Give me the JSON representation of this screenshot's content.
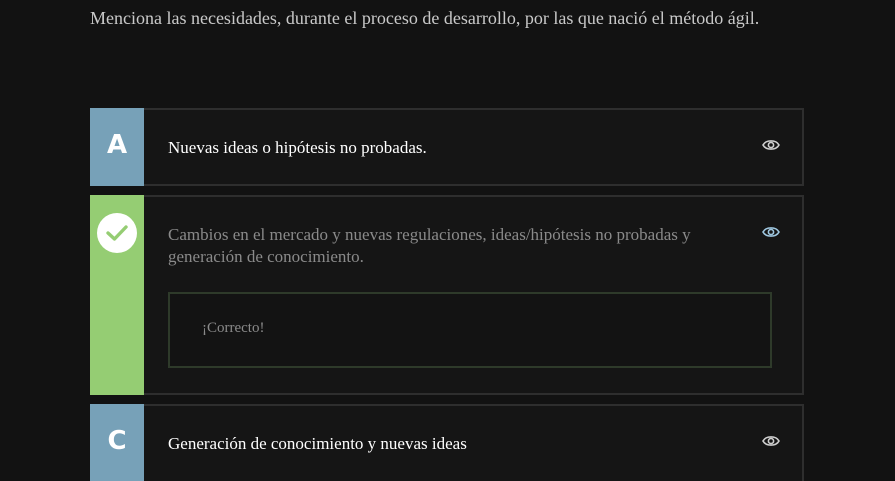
{
  "question": "Menciona las necesidades, durante el proceso de desarrollo, por las que nació el método ágil.",
  "options": [
    {
      "letter": "A",
      "text": "Nuevas ideas o hipótesis no probadas.",
      "state": "unselected",
      "tab_color": "#77a1b8"
    },
    {
      "letter": "",
      "text": "Cambios en el mercado y nuevas regulaciones, ideas/hipótesis no probadas y generación de conocimiento.",
      "state": "correct",
      "tab_color": "#95cd73",
      "icon": "check-icon",
      "feedback": "¡Correcto!"
    },
    {
      "letter": "C",
      "text": "Generación de conocimiento y nuevas ideas",
      "state": "unselected",
      "tab_color": "#77a1b8"
    }
  ],
  "icons": {
    "reveal": "eye-icon"
  },
  "colors": {
    "background": "#121212",
    "tab_blue": "#77a1b8",
    "tab_green": "#95cd73",
    "eye_active": "#9fc7e0",
    "eye_inactive": "#cfcfcf"
  }
}
